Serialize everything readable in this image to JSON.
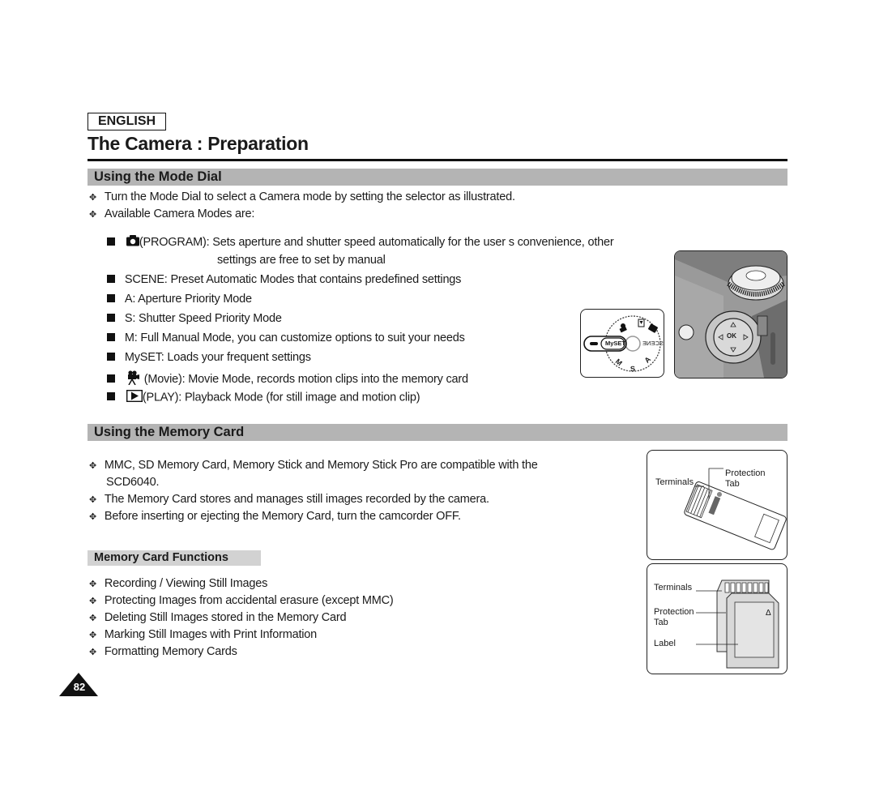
{
  "header": {
    "language": "ENGLISH",
    "title": "The Camera : Preparation"
  },
  "sections": [
    {
      "heading": "Using the Mode Dial",
      "bullets": [
        "Turn the Mode Dial to select a Camera mode by setting the selector as illustrated.",
        "Available Camera Modes are:"
      ],
      "modes": [
        {
          "icon": "camera-icon",
          "text": "(PROGRAM): Sets aperture and shutter speed automatically for the user s convenience, other",
          "continuation": "settings are free to set by manual"
        },
        {
          "icon": "",
          "text": "SCENE: Preset Automatic Modes that contains predefined settings"
        },
        {
          "icon": "",
          "text": "A: Aperture Priority Mode"
        },
        {
          "icon": "",
          "text": "S: Shutter Speed Priority Mode"
        },
        {
          "icon": "",
          "text": "M: Full Manual Mode, you can customize options to suit your needs"
        },
        {
          "icon": "",
          "text": "MySET: Loads your frequent settings"
        },
        {
          "icon": "movie-camera-icon",
          "text": "(Movie): Movie Mode, records motion clips into the memory card"
        },
        {
          "icon": "play-icon",
          "text": "(PLAY): Playback Mode (for still image and motion clip)"
        }
      ],
      "figure_labels": {
        "dial_myset": "MySET",
        "dial_scene": "SCENE",
        "dial_m": "M",
        "dial_s": "S",
        "dial_a": "A",
        "ok": "OK"
      }
    },
    {
      "heading": "Using the Memory Card",
      "bullets": [
        "MMC, SD Memory Card, Memory Stick and Memory Stick Pro are compatible with the",
        "SCD6040.",
        "The Memory Card stores and manages still images recorded by the camera.",
        "Before inserting or ejecting the Memory Card, turn the camcorder OFF."
      ],
      "subsection": {
        "heading": "Memory Card Functions",
        "bullets": [
          "Recording / Viewing Still Images",
          "Protecting Images from accidental erasure (except MMC)",
          "Deleting Still Images stored in the Memory Card",
          "Marking Still Images with Print Information",
          "Formatting Memory Cards"
        ]
      },
      "figure1_labels": {
        "terminals": "Terminals",
        "protection": "Protection",
        "tab": "Tab"
      },
      "figure2_labels": {
        "terminals": "Terminals",
        "protection": "Protection",
        "tab": "Tab",
        "label": "Label"
      }
    }
  ],
  "footer": {
    "page_number": "82"
  }
}
